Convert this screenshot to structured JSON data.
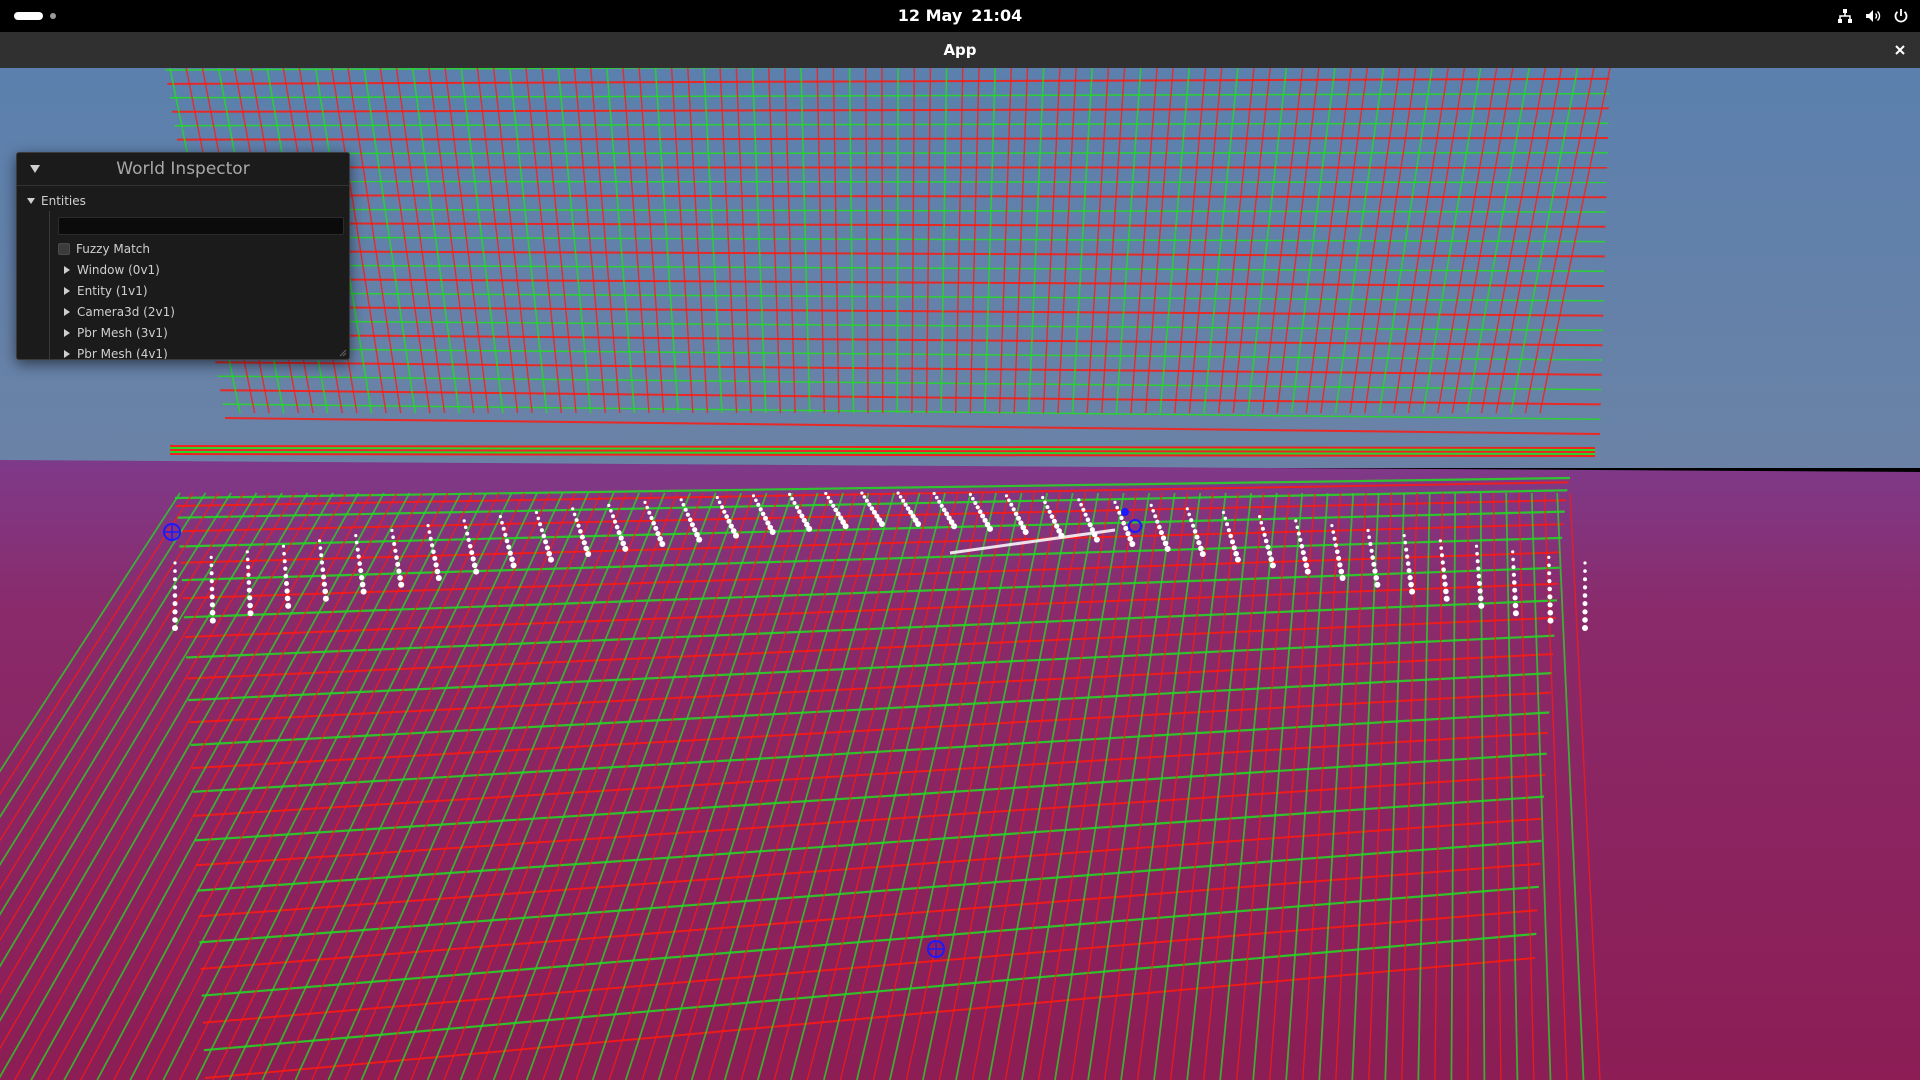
{
  "topbar": {
    "date": "12 May",
    "time": "21:04",
    "tray_icons": [
      "network-icon",
      "volume-icon",
      "power-icon"
    ]
  },
  "window": {
    "title": "App",
    "close_icon": "close-icon"
  },
  "inspector": {
    "title": "World Inspector",
    "section_label": "Entities",
    "search_value": "",
    "fuzzy_label": "Fuzzy Match",
    "fuzzy_checked": false,
    "entities": [
      "Window (0v1)",
      "Entity (1v1)",
      "Camera3d (2v1)",
      "Pbr Mesh (3v1)",
      "Pbr Mesh (4v1)"
    ]
  },
  "scene": {
    "sky_color": "#5e7fa6",
    "ground_color": "#8a2458",
    "grid_red": "#ff1a10",
    "grid_green": "#22dd22",
    "point_color": "#ffffff",
    "gizmo_color": "#1a1aff"
  }
}
